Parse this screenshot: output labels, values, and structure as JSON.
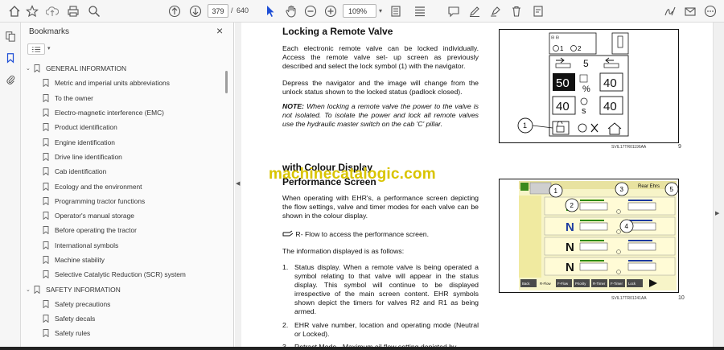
{
  "toolbar": {
    "page_current": "379",
    "page_separator": "/",
    "page_total": "640",
    "zoom": "109%"
  },
  "bookmarks": {
    "title": "Bookmarks",
    "close": "×",
    "items": [
      {
        "label": "GENERAL INFORMATION",
        "level": "section"
      },
      {
        "label": "Metric and imperial units abbreviations",
        "level": "sub"
      },
      {
        "label": "To the owner",
        "level": "sub"
      },
      {
        "label": "Electro-magnetic interference (EMC)",
        "level": "sub"
      },
      {
        "label": "Product identification",
        "level": "sub"
      },
      {
        "label": "Engine identification",
        "level": "sub"
      },
      {
        "label": "Drive line identification",
        "level": "sub"
      },
      {
        "label": "Cab identification",
        "level": "sub"
      },
      {
        "label": "Ecology and the environment",
        "level": "sub"
      },
      {
        "label": "Programming tractor functions",
        "level": "sub"
      },
      {
        "label": "Operator's manual storage",
        "level": "sub"
      },
      {
        "label": "Before operating the tractor",
        "level": "sub"
      },
      {
        "label": "International symbols",
        "level": "sub"
      },
      {
        "label": "Machine stability",
        "level": "sub"
      },
      {
        "label": "Selective Catalytic Reduction (SCR) system",
        "level": "sub"
      },
      {
        "label": "SAFETY INFORMATION",
        "level": "section"
      },
      {
        "label": "Safety precautions",
        "level": "sub"
      },
      {
        "label": "Safety decals",
        "level": "sub"
      },
      {
        "label": "Safety rules",
        "level": "sub"
      }
    ]
  },
  "doc": {
    "heading1": "Locking a Remote Valve",
    "p1": "Each electronic remote valve can be locked individually. Access the remote valve set- up screen as previously described and select the lock symbol (1) with the navigator.",
    "p2": "Depress the navigator and the image will change from the unlock status shown to the locked status (padlock closed).",
    "note_label": "NOTE:",
    "note_text": " When locking a remote valve the power to the valve is not isolated. To isolate the power and lock all remote valves use the hydraulic master switch on the cab 'C' pillar.",
    "heading2a": "with Colour Display",
    "heading2b": "Performance Screen",
    "watermark": "machinecatalogic.com",
    "p3": "When operating with EHR's, a performance screen depicting the flow settings, valve and timer modes for each valve can be shown in the colour display.",
    "p4": "R- Flow to access the performance screen.",
    "p5": "The information displayed is as follows:",
    "list": [
      {
        "num": "1.",
        "text": "Status display. When a remote valve is being operated a symbol relating to that valve will appear in the status display. This symbol will continue to be displayed irrespective of the main screen content. EHR symbols shown depict the timers for valves R2 and R1 as being armed."
      },
      {
        "num": "2.",
        "text": "EHR valve number, location and operating mode (Neutral or Locked)."
      },
      {
        "num": "3.",
        "text": "Retract Mode - Maximum oil flow setting depicted by"
      }
    ],
    "fig1": {
      "caption": "SVIL17TR01196AA",
      "number": "9",
      "callout": "1",
      "val_pct": "50",
      "val_a": "40",
      "val_b": "40",
      "val_c": "40",
      "pct": "%",
      "sec": "s",
      "five": "5",
      "one": "1",
      "two": "2"
    },
    "fig2": {
      "caption": "SVIL17TR01241AA",
      "number": "10",
      "header": "Rear Ehrs",
      "callouts": [
        "1",
        "2",
        "3",
        "4",
        "5"
      ],
      "tabs": [
        "Back",
        "R-Flow",
        "F-Flow",
        "Priority",
        "R-Timer",
        "F-Timer",
        "Lock"
      ],
      "accent": "#f0e000",
      "bar_green": "#2e8b00",
      "bar_blue": "#1c3aa0"
    }
  }
}
